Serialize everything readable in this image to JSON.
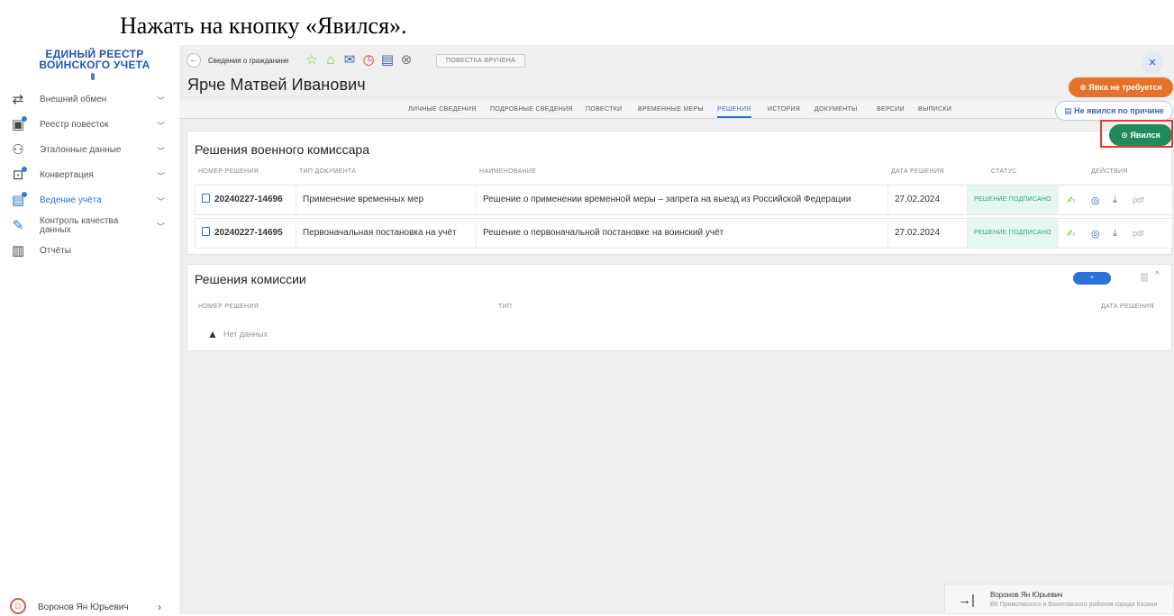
{
  "instruction": "Нажать на кнопку «Явился».",
  "app": {
    "logo_line1": "ЕДИНЫЙ РЕЕСТР",
    "logo_line2": "ВОИНСКОГО УЧЕТА"
  },
  "sidebar": {
    "items": [
      {
        "label": "Внешний обмен",
        "icon": "exchange-icon"
      },
      {
        "label": "Реестр повесток",
        "icon": "summons-registry-icon"
      },
      {
        "label": "Эталонные данные",
        "icon": "reference-data-icon"
      },
      {
        "label": "Конвертация",
        "icon": "conversion-icon"
      },
      {
        "label": "Ведение учёта",
        "icon": "accounting-icon"
      },
      {
        "label": "Контроль качества данных",
        "icon": "quality-control-icon"
      },
      {
        "label": "Отчёты",
        "icon": "reports-icon"
      }
    ],
    "user_name": "Воронов Ян Юрьевич"
  },
  "topbar": {
    "breadcrumb": "Сведения о гражданине",
    "notice_badge": "ПОВЕСТКА ВРУЧЕНА",
    "close": "×"
  },
  "person": {
    "name": "Ярче Матвей Иванович"
  },
  "tabs": [
    "ЛИЧНЫЕ СВЕДЕНИЯ",
    "ПОДРОБНЫЕ СВЕДЕНИЯ",
    "ПОВЕСТКИ",
    "ВРЕМЕННЫЕ МЕРЫ",
    "РЕШЕНИЯ",
    "ИСТОРИЯ",
    "ДОКУМЕНТЫ",
    "ВЕРСИИ",
    "ВЫПИСКИ"
  ],
  "active_tab": "РЕШЕНИЯ",
  "decisions": {
    "title": "Решения военного комиссара",
    "columns": [
      "НОМЕР РЕШЕНИЯ",
      "ТИП ДОКУМЕНТА",
      "НАИМЕНОВАНИЕ",
      "ДАТА РЕШЕНИЯ",
      "СТАТУС",
      "ДЕЙСТВИЯ"
    ],
    "rows": [
      {
        "number": "20240227-14696",
        "type": "Применение временных мер",
        "name": "Решение о применении временной меры – запрета на выезд из Российской Федерации",
        "date": "27.02.2024",
        "status": "РЕШЕНИЕ ПОДПИСАНО",
        "pdf": "pdf"
      },
      {
        "number": "20240227-14695",
        "type": "Первоначальная постановка на учёт",
        "name": "Решение о первоначальной постановке на воинский учёт",
        "date": "27.02.2024",
        "status": "РЕШЕНИЕ ПОДПИСАНО",
        "pdf": "pdf"
      }
    ]
  },
  "commission": {
    "title": "Решения комиссии",
    "add_label": "+ ДОБАВИТЬ",
    "columns": [
      "НОМЕР РЕШЕНИЯ",
      "ТИП",
      "ДАТА РЕШЕНИЯ"
    ],
    "empty": "Нет данных"
  },
  "actions": {
    "not_required": "Явка не требуется",
    "absent_reason": "Не явился по причине",
    "appeared": "Явился"
  },
  "footer": {
    "name": "Воронов Ян Юрьевич",
    "org": "ВК Приволжского и Вахитовского районов города Казани"
  },
  "colors": {
    "accent": "#2a72d8",
    "orange": "#e8712a",
    "green": "#1f8a5e",
    "highlight": "#e53935"
  }
}
